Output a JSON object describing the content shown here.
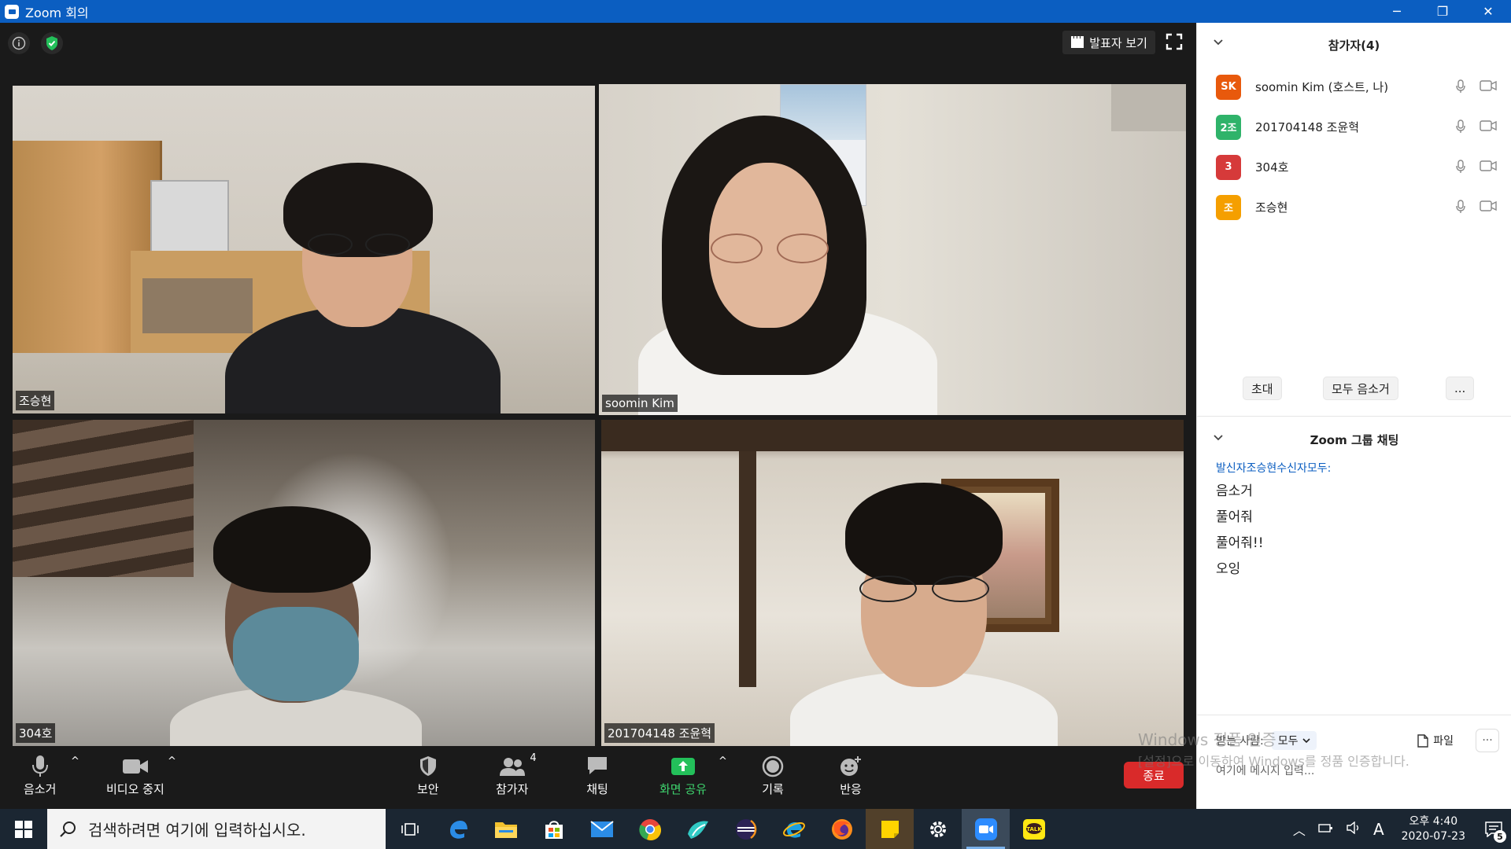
{
  "window": {
    "title": "Zoom 회의",
    "minimize": "─",
    "maximize": "❐",
    "close": "✕"
  },
  "meeting": {
    "speaker_view_label": "발표자 보기",
    "tiles": [
      {
        "name": "조승현"
      },
      {
        "name": "soomin Kim",
        "active": true
      },
      {
        "name": "304호"
      },
      {
        "name": "201704148 조윤혁"
      }
    ]
  },
  "toolbar": {
    "mute": "음소거",
    "stop_video": "비디오 중지",
    "security": "보안",
    "participants": "참가자",
    "participants_count": "4",
    "chat": "채팅",
    "share": "화면 공유",
    "record": "기록",
    "reactions": "반응",
    "end": "종료",
    "caret": "^"
  },
  "participants_panel": {
    "title": "참가자(4)",
    "participants": [
      {
        "initials": "SK",
        "name": "soomin Kim (호스트, 나)",
        "color": "#e8590c"
      },
      {
        "initials": "2조",
        "name": "201704148 조윤혁",
        "color": "#2fb36a"
      },
      {
        "initials": "3",
        "name": "304호",
        "color": "#d63a3a"
      },
      {
        "initials": "조",
        "name": "조승현",
        "color": "#f59f00"
      }
    ],
    "invite": "초대",
    "mute_all": "모두 음소거",
    "more": "..."
  },
  "chat_panel": {
    "title": "Zoom 그룹 채팅",
    "meta_from_label": "발신자",
    "meta_from": "조승현",
    "meta_to_label": "수신자",
    "meta_to": "모두:",
    "messages": [
      "음소거",
      "풀어줘",
      "풀어줘!!",
      "오잉"
    ],
    "send_to_label": "받는 사람:",
    "send_to_value": "모두",
    "file": "파일",
    "more": "···",
    "input_placeholder": "여기에 메시지 입력..."
  },
  "watermark": {
    "line1": "Windows 정품 인증",
    "line2": "[설정]으로 이동하여 Windows를 정품 인증합니다."
  },
  "taskbar": {
    "search_placeholder": "검색하려면 여기에 입력하십시오.",
    "time_period": "오후 4:40",
    "date": "2020-07-23",
    "ime": "A",
    "notifications": "5"
  }
}
